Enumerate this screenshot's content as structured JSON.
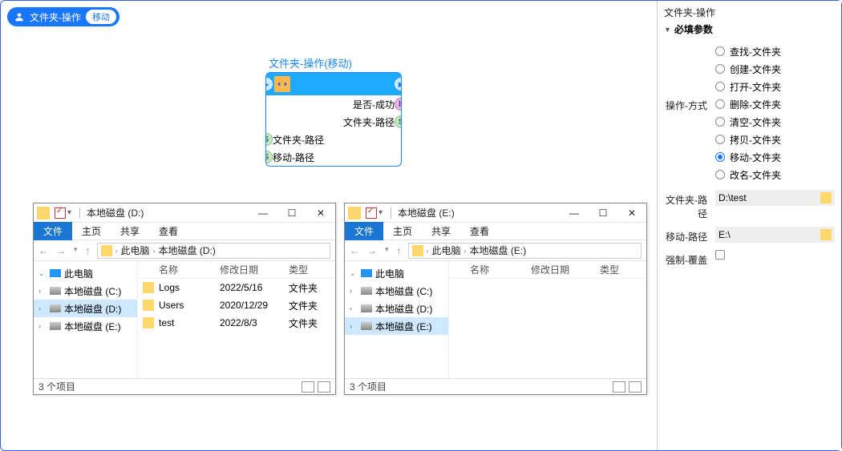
{
  "header": {
    "title": "文件夹-操作",
    "tag": "移动"
  },
  "node": {
    "title": "文件夹-操作(移动)",
    "outputs": [
      {
        "label": "是否-成功",
        "type": "b"
      },
      {
        "label": "文件夹-路径",
        "type": "s"
      }
    ],
    "inputs": [
      {
        "label": "文件夹-路径",
        "type": "s"
      },
      {
        "label": "移动-路径",
        "type": "s"
      }
    ]
  },
  "explorer1": {
    "title": "本地磁盘 (D:)",
    "ribbon": {
      "file": "文件",
      "tabs": [
        "主页",
        "共享",
        "查看"
      ]
    },
    "breadcrumb": [
      "此电脑",
      "本地磁盘 (D:)"
    ],
    "tree": [
      {
        "label": "此电脑",
        "icon": "pc",
        "caret": "v"
      },
      {
        "label": "本地磁盘 (C:)",
        "icon": "hd",
        "caret": ">"
      },
      {
        "label": "本地磁盘 (D:)",
        "icon": "hd",
        "caret": ">",
        "sel": true
      },
      {
        "label": "本地磁盘 (E:)",
        "icon": "hd",
        "caret": ">"
      }
    ],
    "cols": {
      "name": "名称",
      "date": "修改日期",
      "type": "类型"
    },
    "files": [
      {
        "name": "Logs",
        "date": "2022/5/16",
        "type": "文件夹"
      },
      {
        "name": "Users",
        "date": "2020/12/29",
        "type": "文件夹"
      },
      {
        "name": "test",
        "date": "2022/8/3",
        "type": "文件夹"
      }
    ],
    "status": "3 个项目"
  },
  "explorer2": {
    "title": "本地磁盘 (E:)",
    "ribbon": {
      "file": "文件",
      "tabs": [
        "主页",
        "共享",
        "查看"
      ]
    },
    "breadcrumb": [
      "此电脑",
      "本地磁盘 (E:)"
    ],
    "tree": [
      {
        "label": "此电脑",
        "icon": "pc",
        "caret": "v"
      },
      {
        "label": "本地磁盘 (C:)",
        "icon": "hd",
        "caret": ">"
      },
      {
        "label": "本地磁盘 (D:)",
        "icon": "hd",
        "caret": ">"
      },
      {
        "label": "本地磁盘 (E:)",
        "icon": "hd",
        "caret": ">",
        "sel": true
      }
    ],
    "cols": {
      "name": "名称",
      "date": "修改日期",
      "type": "类型"
    },
    "files": [],
    "status": "3 个项目"
  },
  "panel": {
    "title": "文件夹-操作",
    "section": "必填参数",
    "op_label": "操作-方式",
    "ops": [
      "查找-文件夹",
      "创建-文件夹",
      "打开-文件夹",
      "删除-文件夹",
      "清空-文件夹",
      "拷贝-文件夹",
      "移动-文件夹",
      "改名-文件夹"
    ],
    "op_selected": 6,
    "path_label": "文件夹-路径",
    "path_value": "D:\\test",
    "move_label": "移动-路径",
    "move_value": "E:\\",
    "force_label": "强制-覆盖"
  }
}
